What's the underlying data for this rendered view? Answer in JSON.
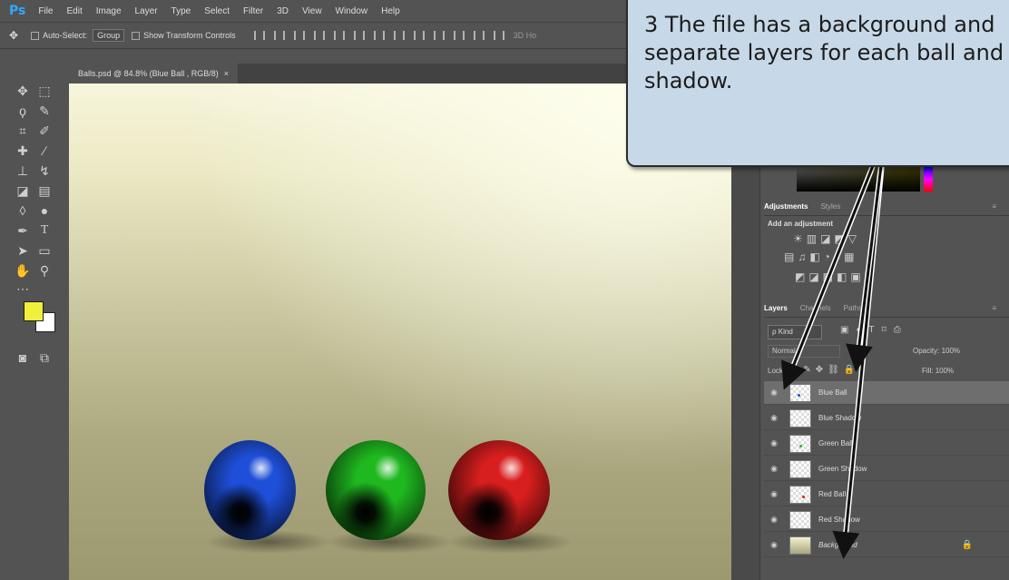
{
  "menubar": {
    "logo": "Ps",
    "items": [
      "File",
      "Edit",
      "Image",
      "Layer",
      "Type",
      "Select",
      "Filter",
      "3D",
      "View",
      "Window",
      "Help"
    ]
  },
  "options_bar": {
    "auto_select_label": "Auto-Select:",
    "auto_select_value": "Group",
    "show_transform_label": "Show Transform Controls",
    "mode_3d_label": "3D Ho"
  },
  "document": {
    "tab_title": "Balls.psd @ 84.8% (Blue Ball , RGB/8)",
    "close_glyph": "×"
  },
  "balls": [
    {
      "name": "Blue Ball",
      "color": "#1e4fd8"
    },
    {
      "name": "Green Ball",
      "color": "#1fb81f"
    },
    {
      "name": "Red Ball",
      "color": "#d81e1e"
    }
  ],
  "panels": {
    "adjust_tabs": [
      "Adjustments",
      "Styles"
    ],
    "adjust_hint": "Add an adjustment",
    "layer_tabs": [
      "Layers",
      "Channels",
      "Paths"
    ],
    "kind_label": "Kind",
    "blend_mode": "Normal",
    "opacity_label": "Opacity:",
    "opacity_value": "100%",
    "lock_label": "Lock:",
    "fill_label": "Fill:",
    "fill_value": "100%"
  },
  "layers": [
    {
      "name": "Blue Ball",
      "selected": true
    },
    {
      "name": "Blue Shadow",
      "selected": false
    },
    {
      "name": "Green Ball",
      "selected": false
    },
    {
      "name": "Green Shadow",
      "selected": false
    },
    {
      "name": "Red Ball",
      "selected": false
    },
    {
      "name": "Red Shadow",
      "selected": false
    },
    {
      "name": "Background",
      "selected": false,
      "locked": true
    }
  ],
  "callout": {
    "text": "3  The file has a background and\nseparate layers for each ball and\nshadow."
  },
  "colors": {
    "foreground": "#f0f03c",
    "background": "#ffffff",
    "callout_fill": "#c7d8e8"
  }
}
